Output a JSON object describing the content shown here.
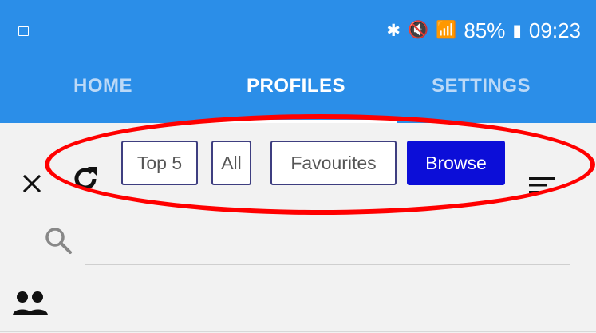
{
  "status_bar": {
    "battery_percent": "85%",
    "time": "09:23",
    "icons": [
      "gallery-icon",
      "bluetooth-icon",
      "mute-icon",
      "wifi-icon",
      "signal-icon",
      "battery-icon"
    ]
  },
  "tabs": [
    {
      "label": "HOME",
      "active": false
    },
    {
      "label": "PROFILES",
      "active": true
    },
    {
      "label": "SETTINGS",
      "active": false
    }
  ],
  "toolbar": {
    "filters": [
      {
        "label": "Top 5",
        "selected": false
      },
      {
        "label": "All",
        "selected": false
      },
      {
        "label": "Favourites",
        "selected": false
      },
      {
        "label": "Browse",
        "selected": true
      }
    ],
    "icons": [
      "close-icon",
      "refresh-icon",
      "sort-icon"
    ]
  },
  "search": {
    "value": "",
    "placeholder": ""
  },
  "colors": {
    "app_bar": "#2b8ee8",
    "selected_chip": "#0c0ed8",
    "chip_border": "#3e3e80",
    "highlight": "#ff0000",
    "background": "#f2f2f2"
  }
}
